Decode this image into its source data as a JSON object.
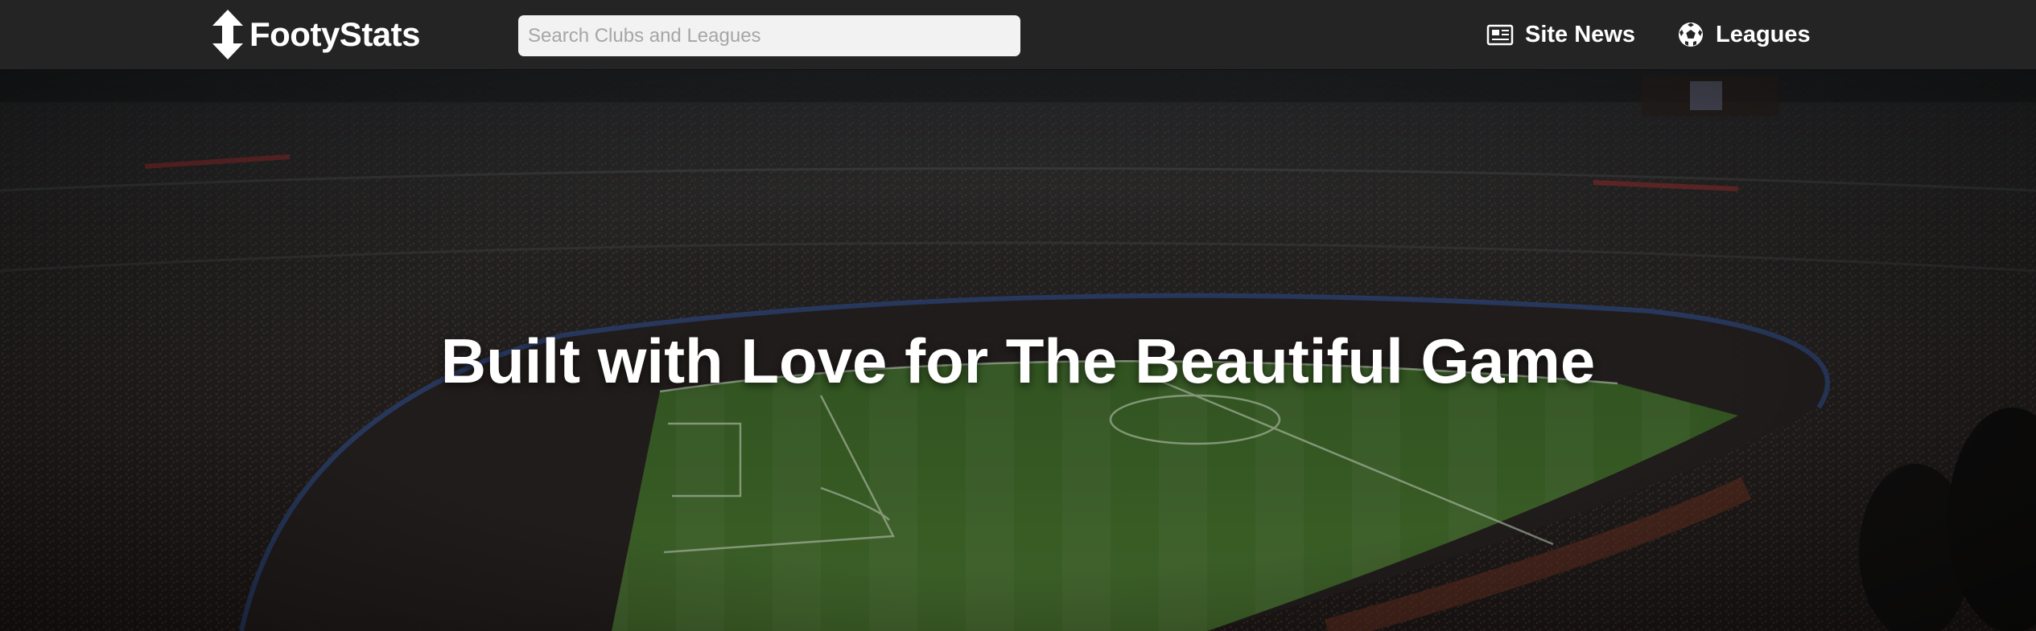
{
  "header": {
    "logo_text": "FootyStats",
    "search_placeholder": "Search Clubs and Leagues",
    "nav": {
      "site_news": "Site News",
      "leagues": "Leagues"
    }
  },
  "hero": {
    "title": "Built with Love for The Beautiful Game"
  },
  "icons": {
    "logo": "up-down-arrow-icon",
    "site_news": "newspaper-icon",
    "leagues": "soccer-ball-icon"
  }
}
